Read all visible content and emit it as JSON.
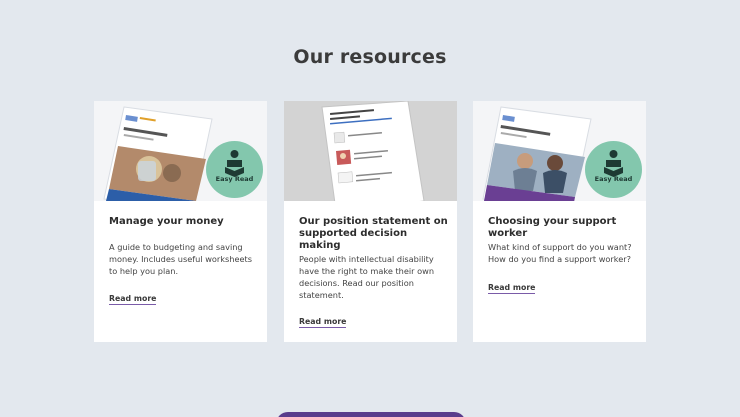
{
  "section": {
    "title": "Our resources"
  },
  "cards": [
    {
      "title": "Manage your money",
      "description": "A guide to budgeting and saving money. Includes useful worksheets to help you plan.",
      "link": "Read more",
      "badge": "Easy Read"
    },
    {
      "title": "Our position statement on supported decision making",
      "description": "People with intellectual disability have the right to make their own decisions. Read our position statement.",
      "link": "Read more"
    },
    {
      "title": "Choosing your support worker",
      "description": "What kind of support do you want? How do you find a support worker?",
      "link": "Read more",
      "badge": "Easy Read"
    }
  ],
  "colors": {
    "background": "#e3e8ee",
    "badge": "#83c7ad",
    "link_underline": "#7a5ba8",
    "button": "#5a3d8c"
  }
}
